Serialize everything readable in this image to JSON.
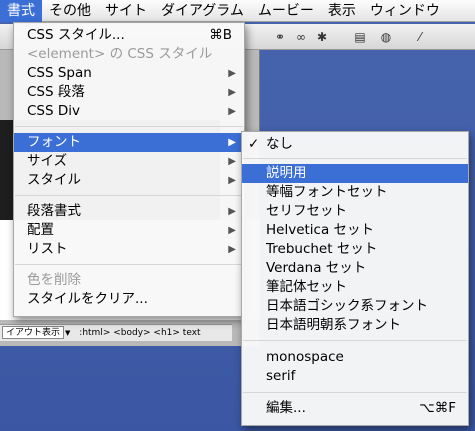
{
  "menubar": {
    "items": [
      "書式",
      "その他",
      "サイト",
      "ダイアグラム",
      "ムービー",
      "表示",
      "ウィンドウ"
    ]
  },
  "main_menu": {
    "items": [
      {
        "label": "CSS スタイル...",
        "shortcut": "⌘B",
        "enabled": true
      },
      {
        "label": "<element> の CSS スタイル",
        "enabled": false
      },
      {
        "label": "CSS Span",
        "submenu": true,
        "enabled": true
      },
      {
        "label": "CSS 段落",
        "submenu": true,
        "enabled": true
      },
      {
        "label": "CSS Div",
        "submenu": true,
        "enabled": true
      },
      {
        "label": "フォント",
        "submenu": true,
        "enabled": true,
        "highlighted": true
      },
      {
        "label": "サイズ",
        "submenu": true,
        "enabled": true
      },
      {
        "label": "スタイル",
        "submenu": true,
        "enabled": true
      },
      {
        "label": "段落書式",
        "submenu": true,
        "enabled": true
      },
      {
        "label": "配置",
        "submenu": true,
        "enabled": true
      },
      {
        "label": "リスト",
        "submenu": true,
        "enabled": true
      },
      {
        "label": "色を削除",
        "enabled": false
      },
      {
        "label": "スタイルをクリア...",
        "enabled": true
      }
    ]
  },
  "font_submenu": {
    "items": [
      {
        "label": "なし",
        "checked": true
      },
      {
        "label": "説明用",
        "highlighted": true
      },
      {
        "label": "等幅フォントセット"
      },
      {
        "label": "セリフセット"
      },
      {
        "label": "Helvetica セット"
      },
      {
        "label": "Trebuchet セット"
      },
      {
        "label": "Verdana セット"
      },
      {
        "label": "筆記体セット"
      },
      {
        "label": "日本語ゴシック系フォント"
      },
      {
        "label": "日本語明朝系フォント"
      },
      {
        "label": "monospace"
      },
      {
        "label": "serif"
      },
      {
        "label": "編集...",
        "shortcut": "⌥⌘F"
      }
    ]
  },
  "status_bar": {
    "mode": "イアウト表示",
    "path": ":html>  <body>  <h1>  text"
  },
  "icons": {
    "check": "✓",
    "submenu_arrow": "▶"
  },
  "colors": {
    "highlight": "#3b6fd6",
    "desktop": "#3b57a3"
  }
}
